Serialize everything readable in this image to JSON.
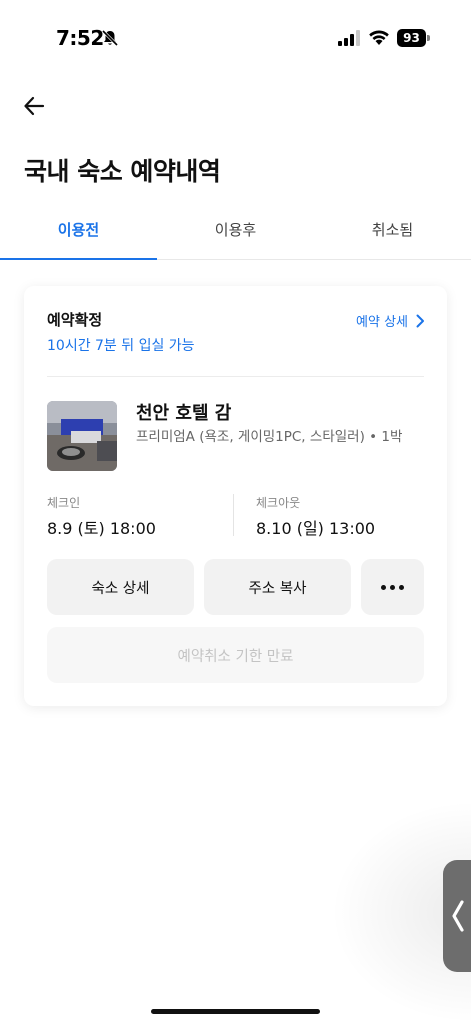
{
  "status_bar": {
    "time": "7:52",
    "battery": "93"
  },
  "header": {
    "title": "국내 숙소 예약내역"
  },
  "tabs": [
    {
      "label": "이용전",
      "active": true
    },
    {
      "label": "이용후",
      "active": false
    },
    {
      "label": "취소됨",
      "active": false
    }
  ],
  "booking": {
    "status": "예약확정",
    "checkin_notice": "10시간 7분 뒤 입실 가능",
    "detail_link": "예약 상세",
    "hotel_name": "천안 호텔 감",
    "room_info": "프리미엄A (욕조, 게이밍1PC, 스타일러) • 1박",
    "checkin_label": "체크인",
    "checkin_value": "8.9 (토) 18:00",
    "checkout_label": "체크아웃",
    "checkout_value": "8.10 (일) 13:00",
    "buttons": {
      "detail": "숙소 상세",
      "copy_address": "주소 복사",
      "cancel": "예약취소 기한 만료"
    }
  },
  "colors": {
    "accent": "#1a73e8",
    "button_bg": "#f2f2f2",
    "disabled_text": "#c4c4c4"
  },
  "icons": [
    "bell-off-icon",
    "signal-icon",
    "wifi-icon",
    "battery-icon",
    "back-arrow-icon",
    "chevron-right-icon",
    "more-icon",
    "chevron-left-icon"
  ]
}
